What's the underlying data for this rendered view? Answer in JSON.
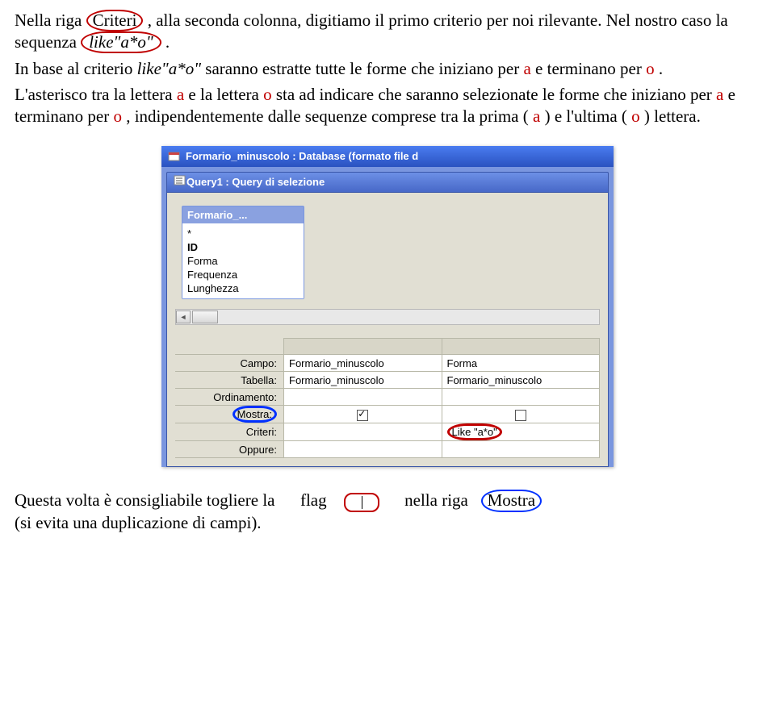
{
  "para1": {
    "t1": "Nella riga ",
    "criteri": "Criteri",
    "t2": " , alla seconda colonna, digitiamo il primo criterio per noi rilevante. Nel nostro caso la sequenza ",
    "like": "like\"a*o\"",
    "t3": " ."
  },
  "para2": {
    "t1": "In base al criterio ",
    "like_it": "like\"a*o\"",
    "t2": " saranno estratte tutte le forme che iniziano per ",
    "a1": "a",
    "t3": " e terminano per ",
    "o1": "o",
    "t4": "."
  },
  "para3": {
    "t1": "L'asterisco tra la lettera ",
    "a": "a",
    "t2": " e la lettera ",
    "o": "o",
    "t3": " sta ad indicare che saranno selezionate le forme che iniziano per ",
    "a2": "a",
    "t4": " e terminano per ",
    "o2": "o",
    "t5": ", indipendentemente dalle sequenze comprese tra la prima (",
    "a3": "a",
    "t6": ") e l'ultima (",
    "o3": "o",
    "t7": ") lettera."
  },
  "shot": {
    "title1": "Formario_minuscolo : Database (formato file d",
    "title2": "Query1 : Query di selezione",
    "tablehead": "Formario_...",
    "fields": {
      "star": "*",
      "id": "ID",
      "forma": "Forma",
      "freq": "Frequenza",
      "lung": "Lunghezza"
    },
    "rows": {
      "campo": "Campo:",
      "tabella": "Tabella:",
      "ordinamento": "Ordinamento:",
      "mostra": "Mostra:",
      "criteri": "Criteri:",
      "oppure": "Oppure:"
    },
    "cells": {
      "c1a": "Formario_minuscolo",
      "c1b": "Forma",
      "c2a": "Formario_minuscolo",
      "c2b": "Formario_minuscolo",
      "crit": "Like \"a*o\""
    }
  },
  "para4": {
    "t1": "Questa volta è consigliabile togliere la",
    "flag": "flag",
    "t2": "nella riga",
    "mostra": "Mostra",
    "t3": "(si evita una duplicazione di campi)."
  }
}
